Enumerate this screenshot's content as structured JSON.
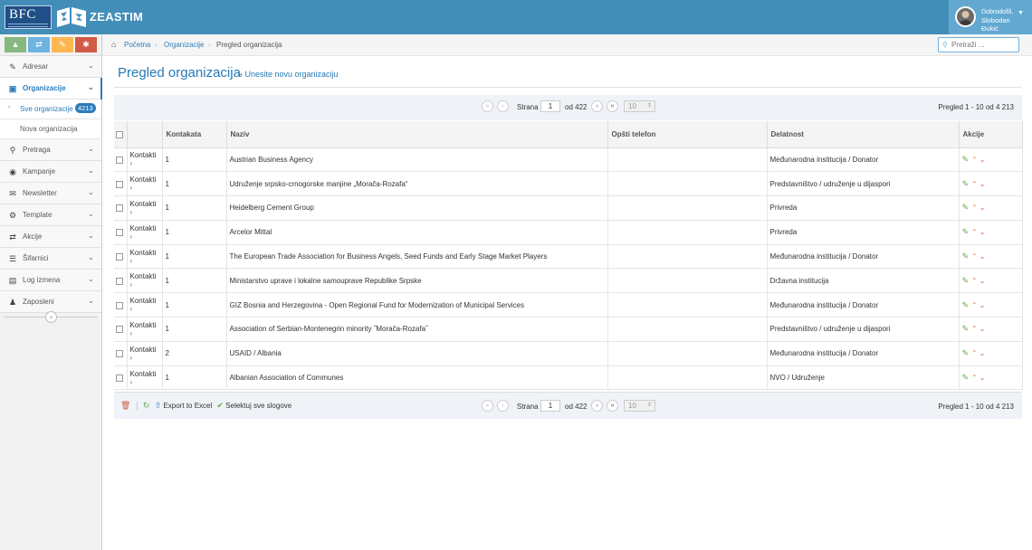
{
  "header": {
    "logo_text": "BFC",
    "brand": "ZEASTIM",
    "user": {
      "greeting": "Dobrodošli,",
      "name_line1": "Slobodan",
      "name_line2": "Đukić"
    }
  },
  "shortcuts": [
    {
      "icon": "signal-icon",
      "color": "#87b87f",
      "glyph": "▲"
    },
    {
      "icon": "exchange-icon",
      "color": "#6fb3e0",
      "glyph": "⇄"
    },
    {
      "icon": "pencil-icon",
      "color": "#ffb752",
      "glyph": "✎"
    },
    {
      "icon": "cogs-icon",
      "color": "#d15b47",
      "glyph": "✱"
    }
  ],
  "sidebar": {
    "items": [
      {
        "label": "Adresar",
        "icon": "edit-icon",
        "glyph": "✎"
      },
      {
        "label": "Organizacije",
        "icon": "briefcase-icon",
        "glyph": "▣",
        "active": true
      },
      {
        "label": "Pretraga",
        "icon": "search-icon",
        "glyph": "⚲"
      },
      {
        "label": "Kampanje",
        "icon": "bullseye-icon",
        "glyph": "◉"
      },
      {
        "label": "Newsletter",
        "icon": "envelope-icon",
        "glyph": "✉"
      },
      {
        "label": "Template",
        "icon": "cogs-icon",
        "glyph": "⚙"
      },
      {
        "label": "Akcije",
        "icon": "exchange-icon",
        "glyph": "⇄"
      },
      {
        "label": "Šifarnici",
        "icon": "list-icon",
        "glyph": "☰"
      },
      {
        "label": "Log izmena",
        "icon": "file-icon",
        "glyph": "▤"
      },
      {
        "label": "Zaposleni",
        "icon": "users-icon",
        "glyph": "♟"
      }
    ],
    "subitems": [
      {
        "label": "Sve organizacije",
        "badge": "4213",
        "active": true
      },
      {
        "label": "Nova organizacija"
      }
    ]
  },
  "breadcrumb": {
    "home": "Početna",
    "section": "Organizacije",
    "current": "Pregled organizacija"
  },
  "search": {
    "placeholder": "Pretraži ..."
  },
  "page": {
    "title": "Pregled organizacija",
    "link": "» Unesite novu organizaciju"
  },
  "pager": {
    "label": "Strana",
    "page": "1",
    "of_label": "od 422",
    "per_page": "10",
    "view": "Pregled 1 - 10 od 4 213"
  },
  "table": {
    "columns": [
      "Kontakata",
      "Naziv",
      "Opšti telefon",
      "Delatnost",
      "Akcije"
    ],
    "kontakti_label": "Kontakti",
    "rows": [
      {
        "count": "1",
        "name": "Austrian Business Agency",
        "phone": "",
        "activity": "Međunarodna institucija / Donator"
      },
      {
        "count": "1",
        "name": "Udruženje srpsko-crnogorske manjine „Morača-Rozafa“",
        "phone": "",
        "activity": "Predstavništvo / udruženje u dijaspori"
      },
      {
        "count": "1",
        "name": "Heidelberg Cement Group",
        "phone": "",
        "activity": "Privreda"
      },
      {
        "count": "1",
        "name": "Arcelor Mittal",
        "phone": "",
        "activity": "Privreda"
      },
      {
        "count": "1",
        "name": "The European Trade Association for Business Angels, Seed Funds and Early Stage Market Players",
        "phone": "",
        "activity": "Međunarodna institucija / Donator"
      },
      {
        "count": "1",
        "name": "Ministarstvo uprave i lokalne samouprave Republike Srpske",
        "phone": "",
        "activity": "Državna institucija"
      },
      {
        "count": "1",
        "name": "GIZ Bosnia and Herzegovina - Open Regional Fund for Modernization of Municipal Services",
        "phone": "",
        "activity": "Međunarodna institucija / Donator"
      },
      {
        "count": "1",
        "name": "Association of Serbian-Montenegrin minority ˝Morača-Rozafa˝",
        "phone": "",
        "activity": "Predstavništvo / udruženje u dijaspori"
      },
      {
        "count": "2",
        "name": "USAID / Albania",
        "phone": "",
        "activity": "Međunarodna institucija / Donator"
      },
      {
        "count": "1",
        "name": "Albanian Association of Communes",
        "phone": "",
        "activity": "NVO / Udruženje"
      }
    ]
  },
  "footer": {
    "export": "Export to Excel",
    "select_all": "Selektuj sve slogove"
  }
}
